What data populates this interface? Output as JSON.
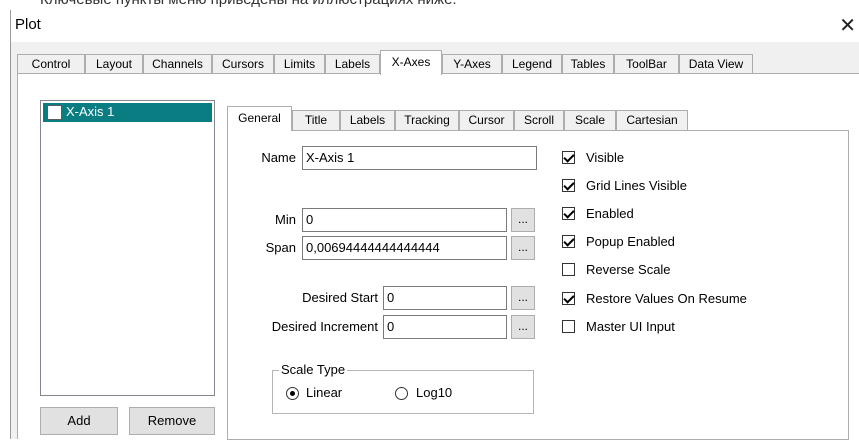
{
  "top_text": "Ключевые пункты меню приведены на иллюстрациях ниже.",
  "window": {
    "title": "Plot",
    "close_glyph": "✕"
  },
  "main_tabs": [
    {
      "label": "Control"
    },
    {
      "label": "Layout"
    },
    {
      "label": "Channels"
    },
    {
      "label": "Cursors"
    },
    {
      "label": "Limits"
    },
    {
      "label": "Labels"
    },
    {
      "label": "X-Axes",
      "active": true
    },
    {
      "label": "Y-Axes"
    },
    {
      "label": "Legend"
    },
    {
      "label": "Tables"
    },
    {
      "label": "ToolBar"
    },
    {
      "label": "Data View"
    }
  ],
  "axis_list": {
    "items": [
      {
        "label": "X-Axis 1",
        "selected": true
      }
    ]
  },
  "buttons": {
    "add": "Add",
    "remove": "Remove"
  },
  "sub_tabs": [
    {
      "label": "General",
      "active": true
    },
    {
      "label": "Title"
    },
    {
      "label": "Labels"
    },
    {
      "label": "Tracking"
    },
    {
      "label": "Cursor"
    },
    {
      "label": "Scroll"
    },
    {
      "label": "Scale"
    },
    {
      "label": "Cartesian"
    }
  ],
  "general": {
    "name_label": "Name",
    "name_value": "X-Axis 1",
    "min_label": "Min",
    "min_value": "0",
    "span_label": "Span",
    "span_value": "0,00694444444444444",
    "desired_start_label": "Desired Start",
    "desired_start_value": "0",
    "desired_increment_label": "Desired Increment",
    "desired_increment_value": "0",
    "ellipsis_label": "...",
    "scale_type": {
      "title": "Scale Type",
      "options": [
        {
          "label": "Linear",
          "selected": true
        },
        {
          "label": "Log10",
          "selected": false
        }
      ]
    },
    "options": [
      {
        "label": "Visible",
        "checked": true
      },
      {
        "label": "Grid Lines Visible",
        "checked": true
      },
      {
        "label": "Enabled",
        "checked": true
      },
      {
        "label": "Popup Enabled",
        "checked": true
      },
      {
        "label": "Reverse Scale",
        "checked": false
      },
      {
        "label": "Restore Values On Resume",
        "checked": true
      },
      {
        "label": "Master UI Input",
        "checked": false
      }
    ]
  },
  "colors": {
    "selection": "#0a7d83",
    "window_bg": "#f0f0f0"
  }
}
